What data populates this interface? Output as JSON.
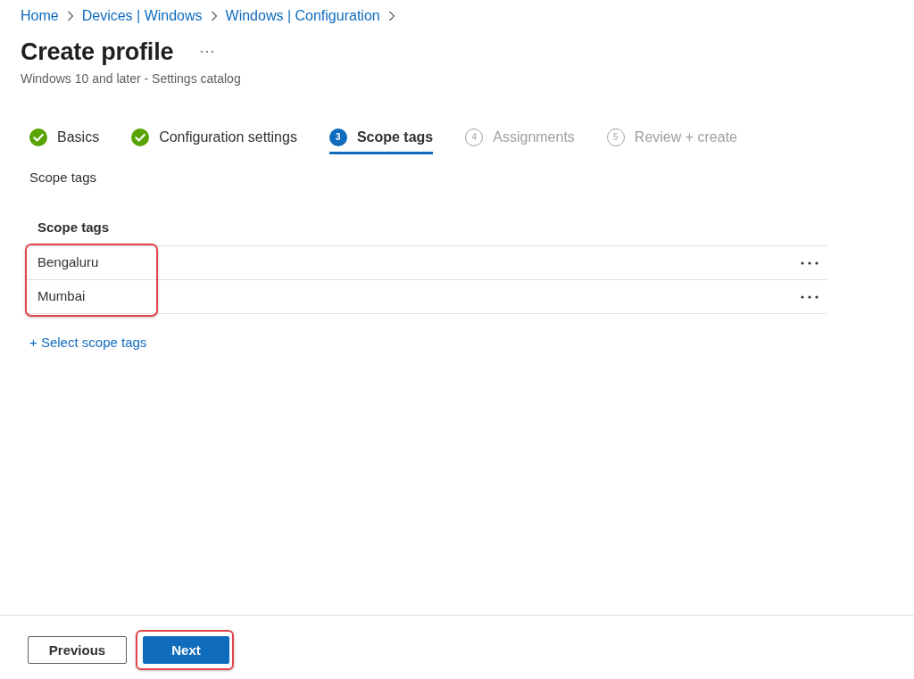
{
  "breadcrumb": [
    {
      "label": "Home"
    },
    {
      "label": "Devices | Windows"
    },
    {
      "label": "Windows | Configuration"
    }
  ],
  "page": {
    "title": "Create profile",
    "subtitle": "Windows 10 and later - Settings catalog"
  },
  "steps": [
    {
      "label": "Basics",
      "kind": "done",
      "selected": false
    },
    {
      "label": "Configuration settings",
      "kind": "done",
      "selected": false
    },
    {
      "number": "3",
      "label": "Scope tags",
      "kind": "current",
      "selected": true
    },
    {
      "number": "4",
      "label": "Assignments",
      "kind": "pending",
      "selected": false
    },
    {
      "number": "5",
      "label": "Review + create",
      "kind": "pending",
      "selected": false
    }
  ],
  "section_label": "Scope tags",
  "scope_tags": {
    "column": "Scope tags",
    "highlighted": true,
    "rows": [
      {
        "name": "Bengaluru"
      },
      {
        "name": "Mumbai"
      }
    ],
    "add_link": "+ Select scope tags"
  },
  "footer": {
    "buttons": [
      {
        "label": "Previous",
        "kind": "secondary",
        "highlighted": false
      },
      {
        "label": "Next",
        "kind": "primary",
        "highlighted": true
      }
    ]
  }
}
